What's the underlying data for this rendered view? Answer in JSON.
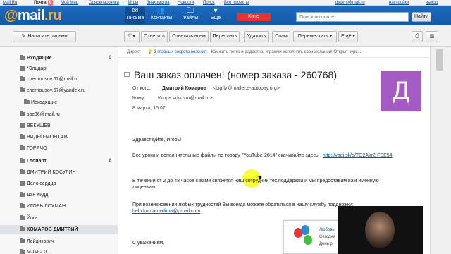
{
  "topbar": {
    "items": [
      "Mail.Ru",
      "Почта",
      "Мой Мир",
      "Одноклассники",
      "Игры",
      "Знакомства",
      "Новости",
      "Поиск",
      "Все проекты"
    ],
    "mail_count": "9",
    "user": "dvdvm@mail.ru",
    "settings": "настройки",
    "logout": "выход"
  },
  "header": {
    "logo_at": "@",
    "logo_mail": "mail",
    "logo_ru": ".ru",
    "nav": [
      {
        "label": "Письма",
        "icon": "✉"
      },
      {
        "label": "Контакты",
        "icon": "👥"
      },
      {
        "label": "Файлы",
        "icon": "🗀"
      },
      {
        "label": "Ещё",
        "icon": "▾"
      }
    ],
    "kino": "Кино",
    "search_placeholder": "Поиск по почте",
    "search_button": "Найти"
  },
  "toolbar": {
    "compose": "Написать письмо",
    "reply": "Ответить",
    "reply_all": "Ответить всем",
    "forward": "Переслать",
    "delete": "Удалить",
    "spam": "Спам",
    "move": "Переместить",
    "more": "Ещё"
  },
  "sidebar": {
    "items": [
      {
        "label": "Входящие",
        "count": "9",
        "bold": true
      },
      {
        "label": "*Эльдар!",
        "count": ""
      },
      {
        "label": "chernousov.67@mail.ru",
        "count": ""
      },
      {
        "label": "chernousov.67@yandex.ru",
        "count": ""
      },
      {
        "label": "Исходящие",
        "count": ""
      },
      {
        "label": "sbc36@mail.ru",
        "count": ""
      },
      {
        "label": "ВЕКУШЕВ",
        "count": ""
      },
      {
        "label": "ВИДЕО-МОНТАЖ",
        "count": ""
      },
      {
        "label": "ГОРЯЧО",
        "count": ""
      },
      {
        "label": "Глопарт",
        "count": "8",
        "bold": true
      },
      {
        "label": "ДМИТРИЙ КОСУЛИН",
        "count": ""
      },
      {
        "label": "Дело сердца",
        "count": ""
      },
      {
        "label": "Дэн Кидд",
        "count": ""
      },
      {
        "label": "ИГОРЬ ЛОХМАН",
        "count": ""
      },
      {
        "label": "Йога",
        "count": ""
      },
      {
        "label": "КОМАРОВ ДМИТРИЙ",
        "count": "",
        "bold": true
      },
      {
        "label": "Лейцикович",
        "count": ""
      },
      {
        "label": "МЛМ-2.0",
        "count": ""
      }
    ]
  },
  "main": {
    "ad": {
      "label": "Директ",
      "link": "3 главных секрета везения:",
      "text": "Как жить легко и радостно, играючи исполнять свои желания! Открыт курс..."
    },
    "subject": "Ваш заказ оплачен! (номер заказа - 260768)",
    "from_label": "От кого:",
    "from_name": "Дмитрий Комаров",
    "from_email": "<bigfly@mailer.e-autopay.org>",
    "to_label": "Кому:",
    "to_value": "Игорь <dvdvm@mail.ru>",
    "date": "8 марта, 15:07",
    "avatar_letter": "Д",
    "body": {
      "greeting": "Здравствуйте, Игорь!",
      "p1": "Все уроки и дополнительные файлы по товару \"YouTube-2014\" скачивайте здесь -",
      "p1_link": "http://yadi.sk/d/TO2Akr2-FEE54",
      "p2_line1": "В течении от 2 до 48 часов с вами свяжется наш сотрудник тех.поддержки и мы предоставим вам именную",
      "p2_line2": "лицензию.",
      "p3": "При возникновении любых трудностей Вы всегда можете обратиться в нашу службу поддержки:",
      "p3_link": "help.komarovdima@gmail.com",
      "closing": "С уважением,"
    }
  },
  "popup": {
    "title": "Любовь",
    "line2": "Сегодня",
    "line3": "День р"
  },
  "colors": {
    "header_blue": "#1e6bbf",
    "logo_orange": "#ffa930",
    "kino_red": "#e8322e",
    "avatar_purple": "#a55bc4",
    "link_blue": "#1a4f94",
    "highlight_yellow": "#f8ff2a"
  }
}
